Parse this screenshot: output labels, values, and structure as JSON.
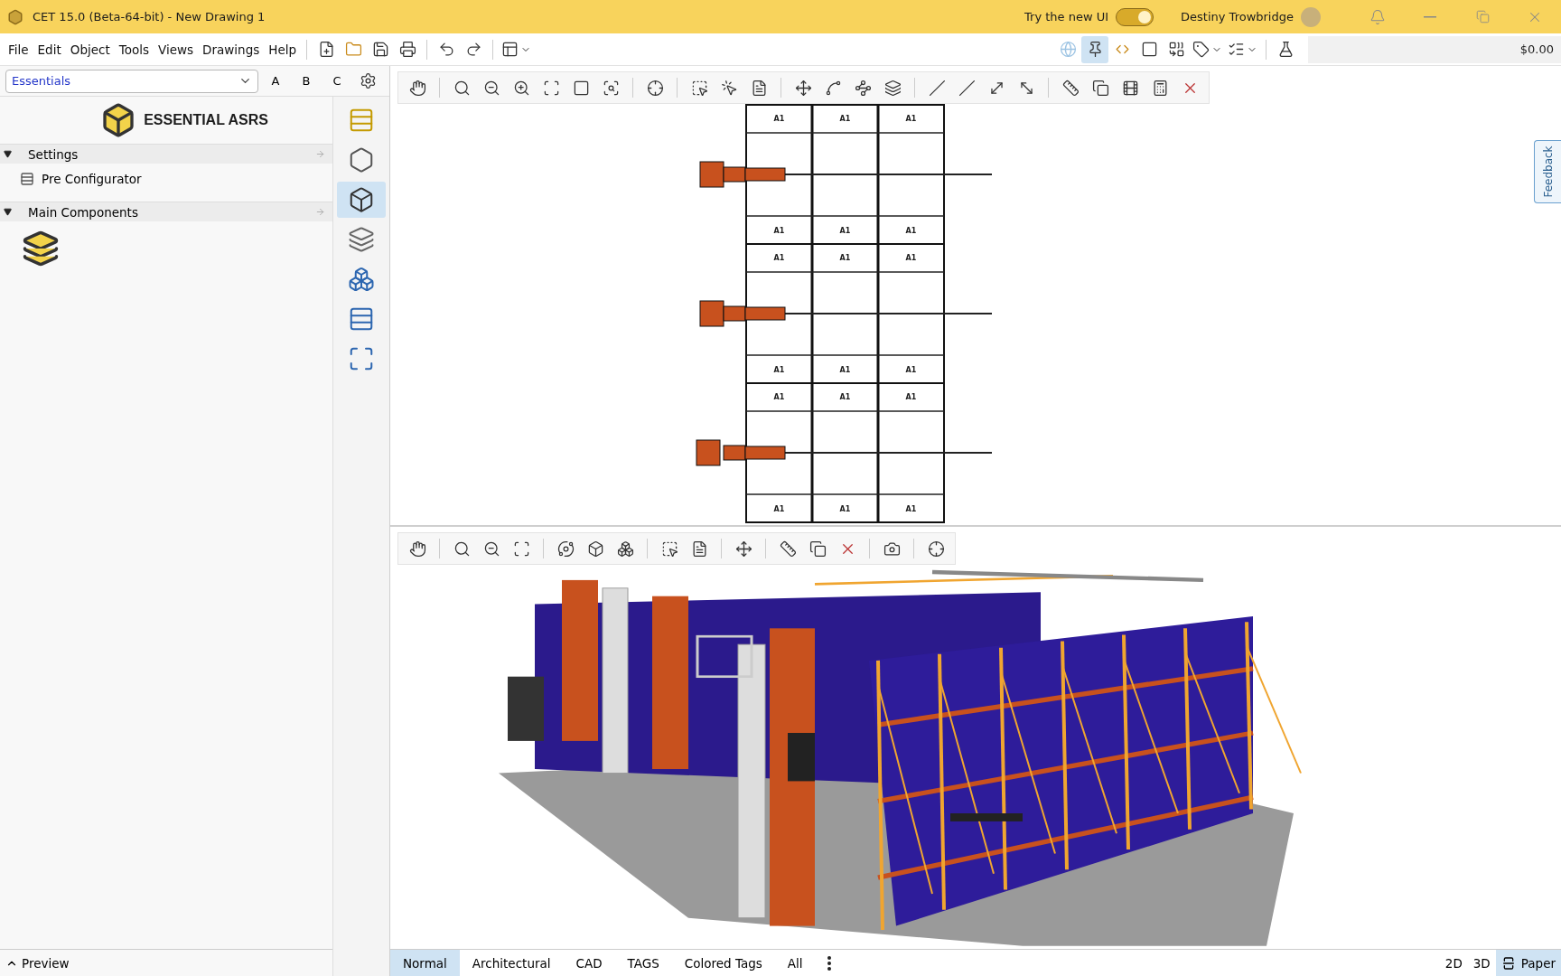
{
  "window": {
    "title": "CET 15.0 (Beta-64-bit) - New Drawing 1",
    "new_ui_toggle": {
      "label": "Try the new UI",
      "on": true
    },
    "user": "Destiny Trowbridge"
  },
  "menu": [
    "File",
    "Edit",
    "Object",
    "Tools",
    "Views",
    "Drawings",
    "Help"
  ],
  "right_tools": [
    {
      "selected": false
    },
    {
      "selected": true
    },
    {
      "selected": false
    },
    {
      "selected": false
    },
    {
      "selected": false
    },
    {
      "selected": false
    },
    {
      "selected": false
    }
  ],
  "price": "$0.00",
  "panel": {
    "dropdown": "Essentials",
    "letter_buttons": [
      "A",
      "B",
      "C"
    ],
    "title": "ESSENTIAL ASRS",
    "sections": [
      {
        "label": "Settings",
        "expanded": true,
        "items": [
          {
            "kind": "link",
            "label": "Pre Configurator"
          }
        ]
      },
      {
        "label": "Main Components",
        "expanded": true,
        "items": [
          {
            "kind": "component"
          }
        ]
      }
    ]
  },
  "category_icons": [
    {
      "selected": false
    },
    {
      "selected": false
    },
    {
      "selected": true
    },
    {
      "selected": false
    },
    {
      "selected": false
    },
    {
      "selected": false
    },
    {
      "selected": false
    }
  ],
  "drawing_2d": {
    "bays": [
      {
        "top_labels": [
          "A1",
          "A1",
          "A1"
        ],
        "bottom_labels": [
          "A1",
          "A1",
          "A1"
        ]
      },
      {
        "top_labels": [
          "A1",
          "A1",
          "A1"
        ],
        "bottom_labels": [
          "A1",
          "A1",
          "A1"
        ]
      },
      {
        "top_labels": [
          "A1",
          "A1",
          "A1"
        ],
        "bottom_labels": [
          "A1",
          "A1",
          "A1"
        ]
      }
    ]
  },
  "feedback_tab": "Feedback",
  "layer_tabs": [
    {
      "label": "Normal",
      "selected": true
    },
    {
      "label": "Architectural",
      "selected": false
    },
    {
      "label": "CAD",
      "selected": false
    },
    {
      "label": "TAGS",
      "selected": false
    },
    {
      "label": "Colored Tags",
      "selected": false
    },
    {
      "label": "All",
      "selected": false
    }
  ],
  "view_modes": [
    {
      "label": "2D",
      "selected": false
    },
    {
      "label": "3D",
      "selected": false
    },
    {
      "label": "Paper",
      "selected": true
    }
  ],
  "preview": {
    "label": "Preview",
    "expanded": false
  }
}
